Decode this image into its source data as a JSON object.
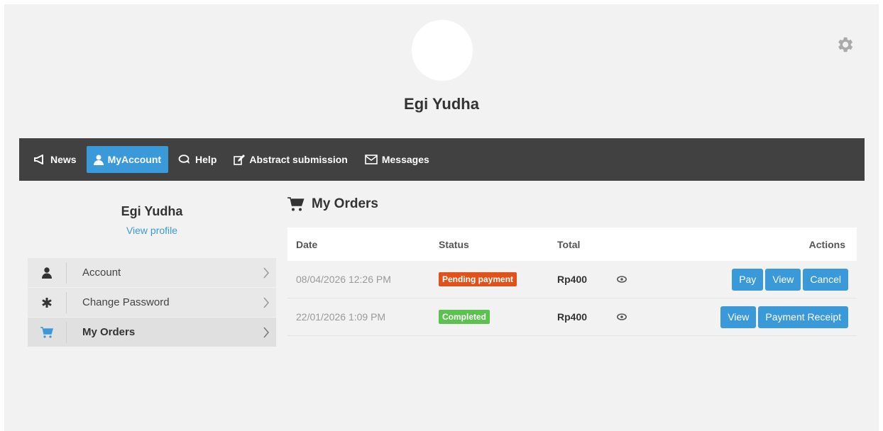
{
  "profile": {
    "name": "Egi Yudha"
  },
  "nav": {
    "items": [
      {
        "label": "News",
        "icon": "megaphone-icon",
        "active": false
      },
      {
        "label": "MyAccount",
        "icon": "user-icon",
        "active": true
      },
      {
        "label": "Help",
        "icon": "chat-icon",
        "active": false
      },
      {
        "label": "Abstract submission",
        "icon": "edit-icon",
        "active": false
      },
      {
        "label": "Messages",
        "icon": "envelope-icon",
        "active": false
      }
    ]
  },
  "sidebar": {
    "name": "Egi Yudha",
    "view_profile": "View profile",
    "items": [
      {
        "label": "Account",
        "icon": "user-icon"
      },
      {
        "label": "Change Password",
        "icon": "asterisk-icon"
      },
      {
        "label": "My Orders",
        "icon": "cart-icon",
        "active": true
      }
    ]
  },
  "orders": {
    "title": "My Orders",
    "headers": {
      "date": "Date",
      "status": "Status",
      "total": "Total",
      "actions": "Actions"
    },
    "rows": [
      {
        "date": "08/04/2026 12:26 PM",
        "status": "Pending payment",
        "total": "Rp400",
        "actions": [
          "Pay",
          "View",
          "Cancel"
        ]
      },
      {
        "date": "22/01/2026 1:09 PM",
        "status": "Completed",
        "total": "Rp400",
        "actions": [
          "View",
          "Payment Receipt"
        ]
      }
    ]
  },
  "colors": {
    "accent": "#3a9ad9",
    "navbar": "#414141",
    "pending": "#e1521b",
    "completed": "#5cc24f"
  }
}
